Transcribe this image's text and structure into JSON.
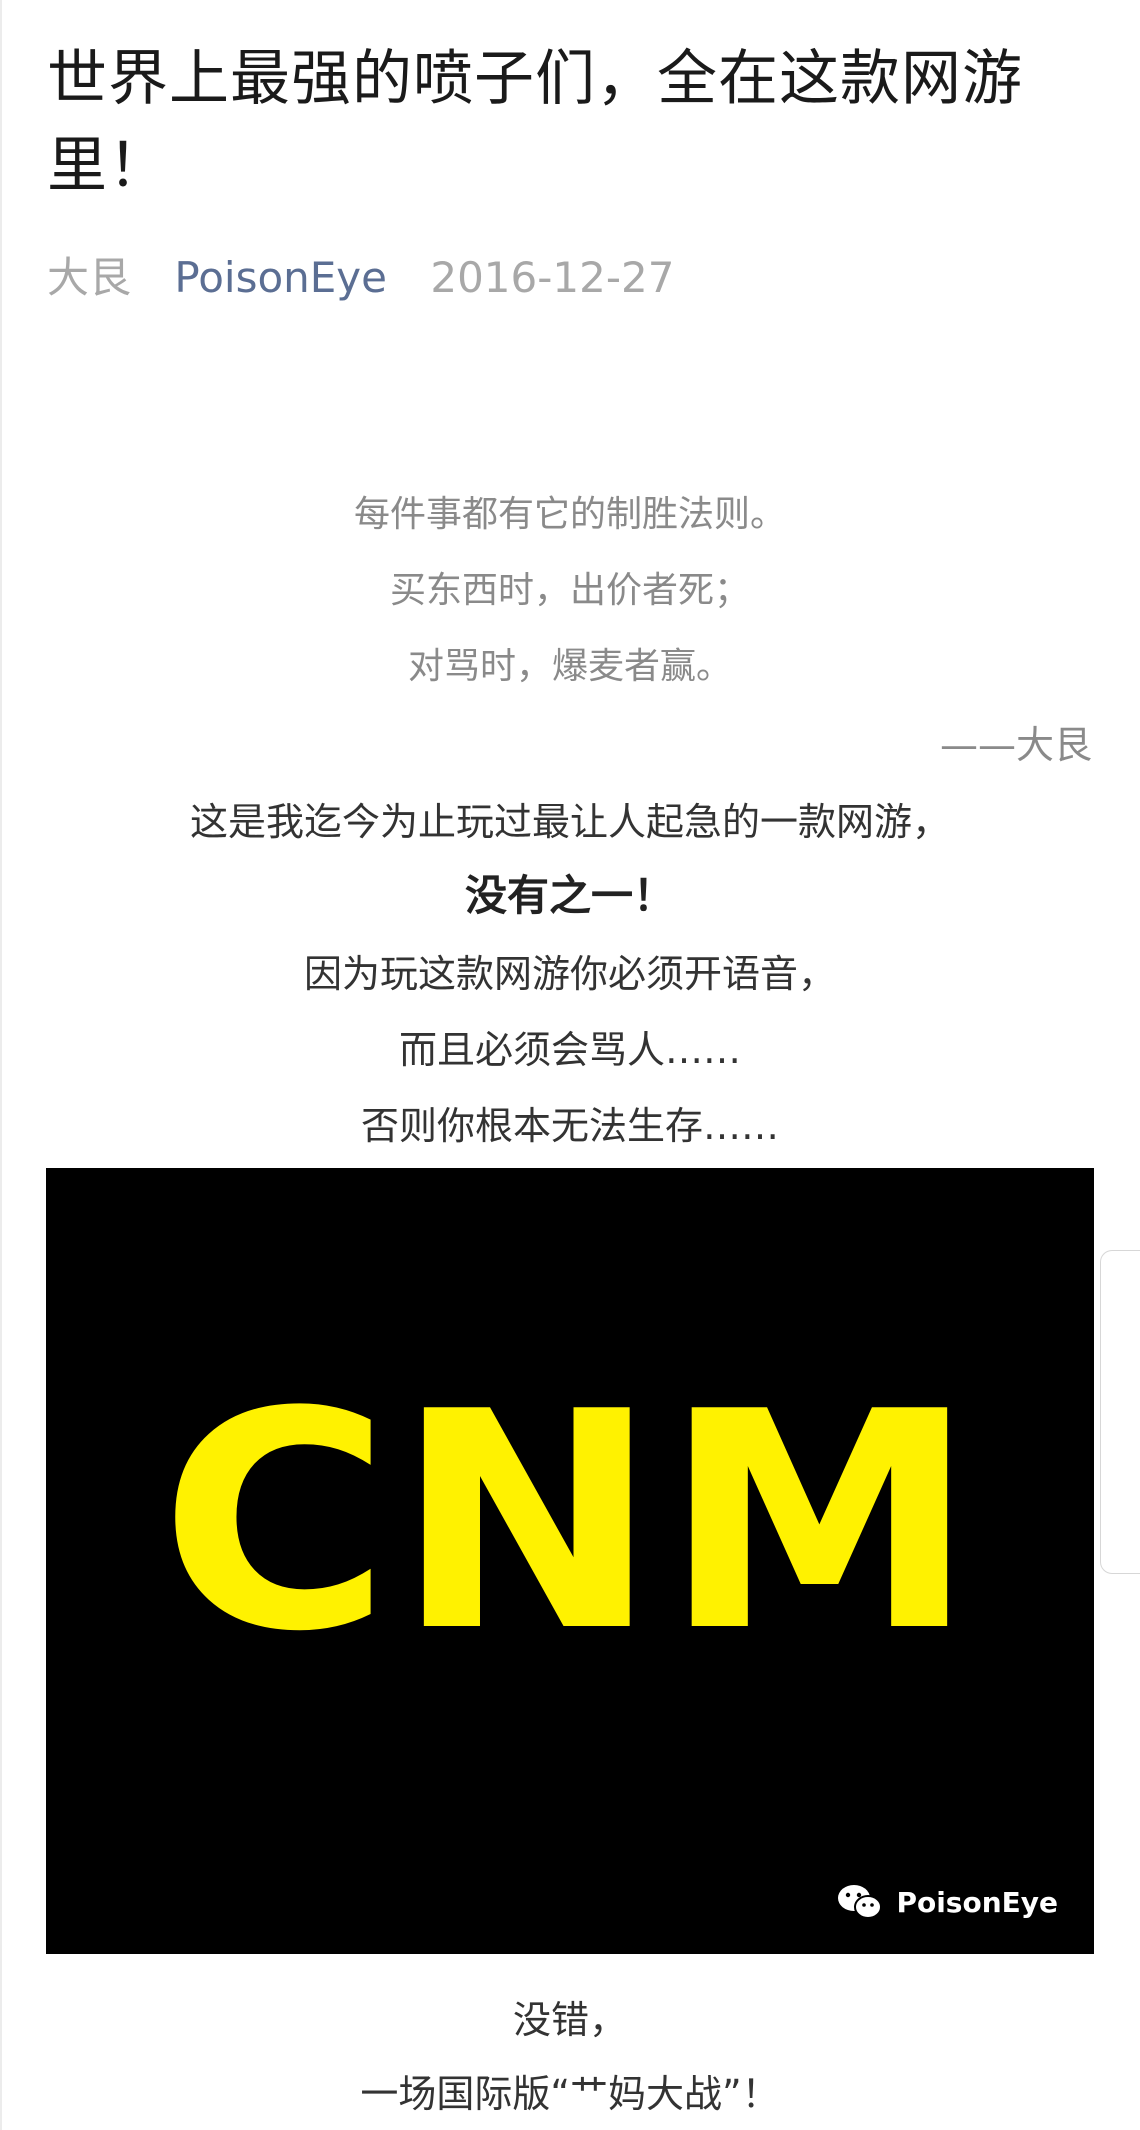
{
  "article": {
    "title": "世界上最强的喷子们，全在这款网游里！",
    "author": "大艮",
    "account": "PoisonEye",
    "date": "2016-12-27"
  },
  "quote": {
    "lines": [
      "每件事都有它的制胜法则。",
      "买东西时，出价者死；",
      "对骂时，爆麦者赢。"
    ],
    "signature": "——大艮"
  },
  "body": {
    "lines": [
      "这是我迄今为止玩过最让人起急的一款网游，",
      "没有之一！",
      "因为玩这款网游你必须开语音，",
      "而且必须会骂人……",
      "否则你根本无法生存……"
    ],
    "after_image": [
      "没错，",
      "一场国际版“艹妈大战”！"
    ]
  },
  "image": {
    "text": "CNM",
    "watermark": "PoisonEye",
    "text_color": "#fff200",
    "background": "#000000"
  },
  "colors": {
    "title": "#1a1a1a",
    "meta_gray": "#a8a8a8",
    "account_blue": "#5b6e93",
    "quote_gray": "#8a8a8a"
  }
}
